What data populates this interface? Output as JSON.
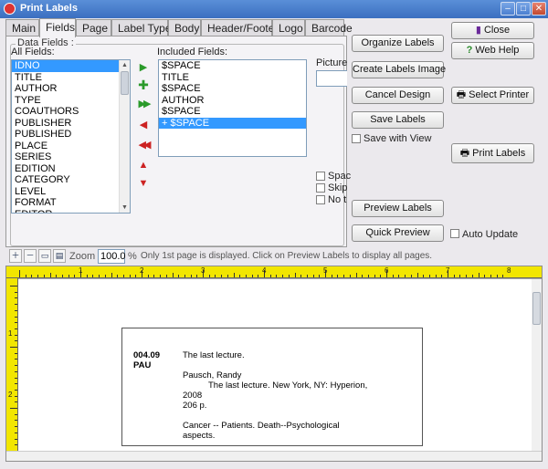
{
  "window": {
    "title": "Print Labels"
  },
  "tabs": [
    {
      "label": "Main"
    },
    {
      "label": "Fields"
    },
    {
      "label": "Page"
    },
    {
      "label": "Label Type"
    },
    {
      "label": "Body"
    },
    {
      "label": "Header/Footer"
    },
    {
      "label": "Logo"
    },
    {
      "label": "Barcode"
    }
  ],
  "data_fields": {
    "group_title": "Data Fields :",
    "all_fields_label": "All Fields:",
    "all_fields": [
      "IDNO",
      "TITLE",
      "AUTHOR",
      "TYPE",
      "COAUTHORS",
      "PUBLISHER",
      "PUBLISHED",
      "PLACE",
      "SERIES",
      "EDITION",
      "CATEGORY",
      "LEVEL",
      "FORMAT",
      "EDITOR"
    ],
    "included_label": "Included Fields:",
    "included_fields": [
      "$SPACE",
      "TITLE",
      "$SPACE",
      "AUTHOR",
      "$SPACE",
      "+ $SPACE"
    ],
    "picture_label": "Picture",
    "options": [
      {
        "label": "Spac",
        "checked": false
      },
      {
        "label": "Skip",
        "checked": false
      },
      {
        "label": "No t",
        "checked": false
      }
    ]
  },
  "actions": {
    "organize": "Organize Labels",
    "create_image": "Create Labels Image",
    "cancel": "Cancel Design",
    "save": "Save Labels",
    "save_with_view": "Save with View",
    "preview": "Preview Labels",
    "quick_preview": "Quick Preview",
    "auto_update": "Auto Update",
    "close": "Close",
    "web_help": "Web Help",
    "select_printer": "Select Printer",
    "print_labels": "Print Labels"
  },
  "toolbar": {
    "zoom_label": "Zoom",
    "zoom_value": "100.0",
    "percent": "%",
    "info": "Only 1st page is displayed. Click on Preview Labels to display all pages."
  },
  "ruler": {
    "h_numbers": [
      "1",
      "2",
      "3",
      "4",
      "5",
      "6",
      "7",
      "8"
    ],
    "v_numbers": [
      "1",
      "2"
    ]
  },
  "label": {
    "call_number": "004.09",
    "call_suffix": "PAU",
    "line1": "The last lecture.",
    "line2": "Pausch, Randy",
    "line3": "The last lecture. New York, NY: Hyperion,",
    "line4": "2008",
    "line5": "206 p.",
    "line6": "Cancer -- Patients.    Death--Psychological",
    "line7": "aspects."
  },
  "colors": {
    "selection": "#3399ff",
    "ruler": "#f2e600",
    "titlebar": "#3b6fc0"
  }
}
